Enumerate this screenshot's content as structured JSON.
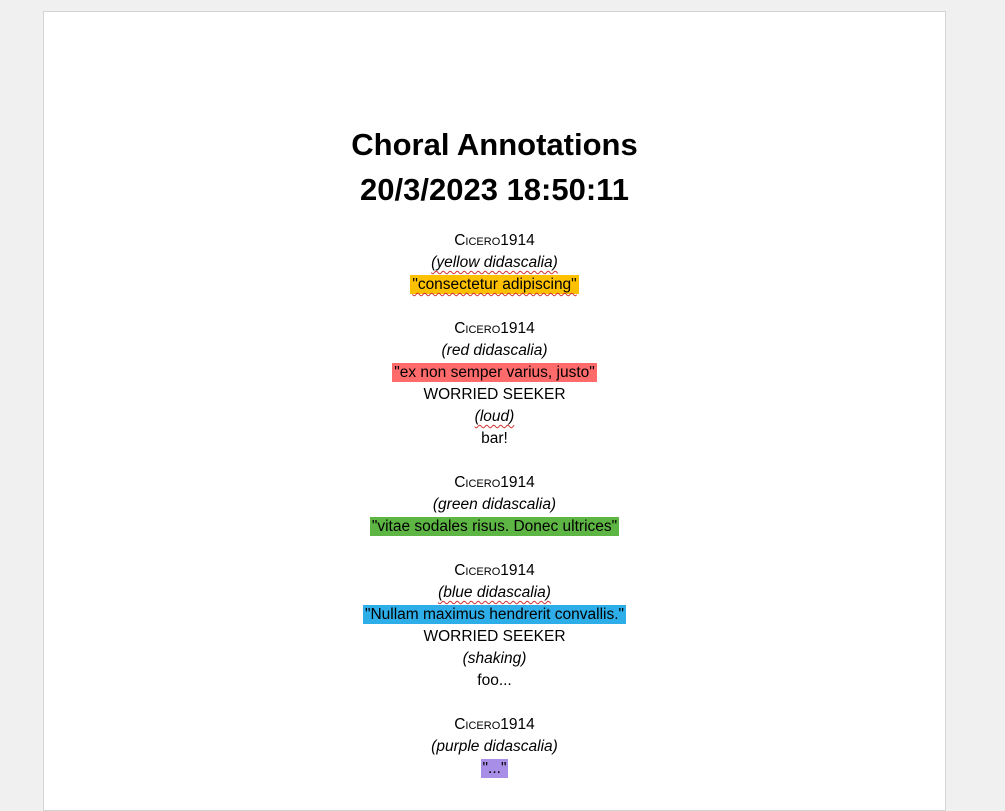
{
  "document": {
    "title_line1": "Choral Annotations",
    "title_line2": "20/3/2023 18:50:11"
  },
  "entries": [
    {
      "speaker": "Cicero1914",
      "direction": "(yellow didascalia)",
      "quote": "\"consectetur adipiscing\"",
      "highlight": "#ffc000"
    },
    {
      "speaker": "Cicero1914",
      "direction": "(red didascalia)",
      "quote": "\"ex non semper varius, justo\"",
      "highlight": "#ff6b6b",
      "reply": {
        "speaker": "WORRIED SEEKER",
        "direction": "(loud)",
        "text": "bar!"
      }
    },
    {
      "speaker": "Cicero1914",
      "direction": "(green didascalia)",
      "quote": "\"vitae sodales risus. Donec ultrices\"",
      "highlight": "#5db543"
    },
    {
      "speaker": "Cicero1914",
      "direction": "(blue didascalia)",
      "quote": "\"Nullam maximus hendrerit convallis.\"",
      "highlight": "#2eaee8",
      "reply": {
        "speaker": "WORRIED SEEKER",
        "direction": "(shaking)",
        "text": "foo..."
      }
    },
    {
      "speaker": "Cicero1914",
      "direction": "(purple didascalia)",
      "quote": "\"...\"",
      "highlight": "#a98ee8"
    }
  ]
}
